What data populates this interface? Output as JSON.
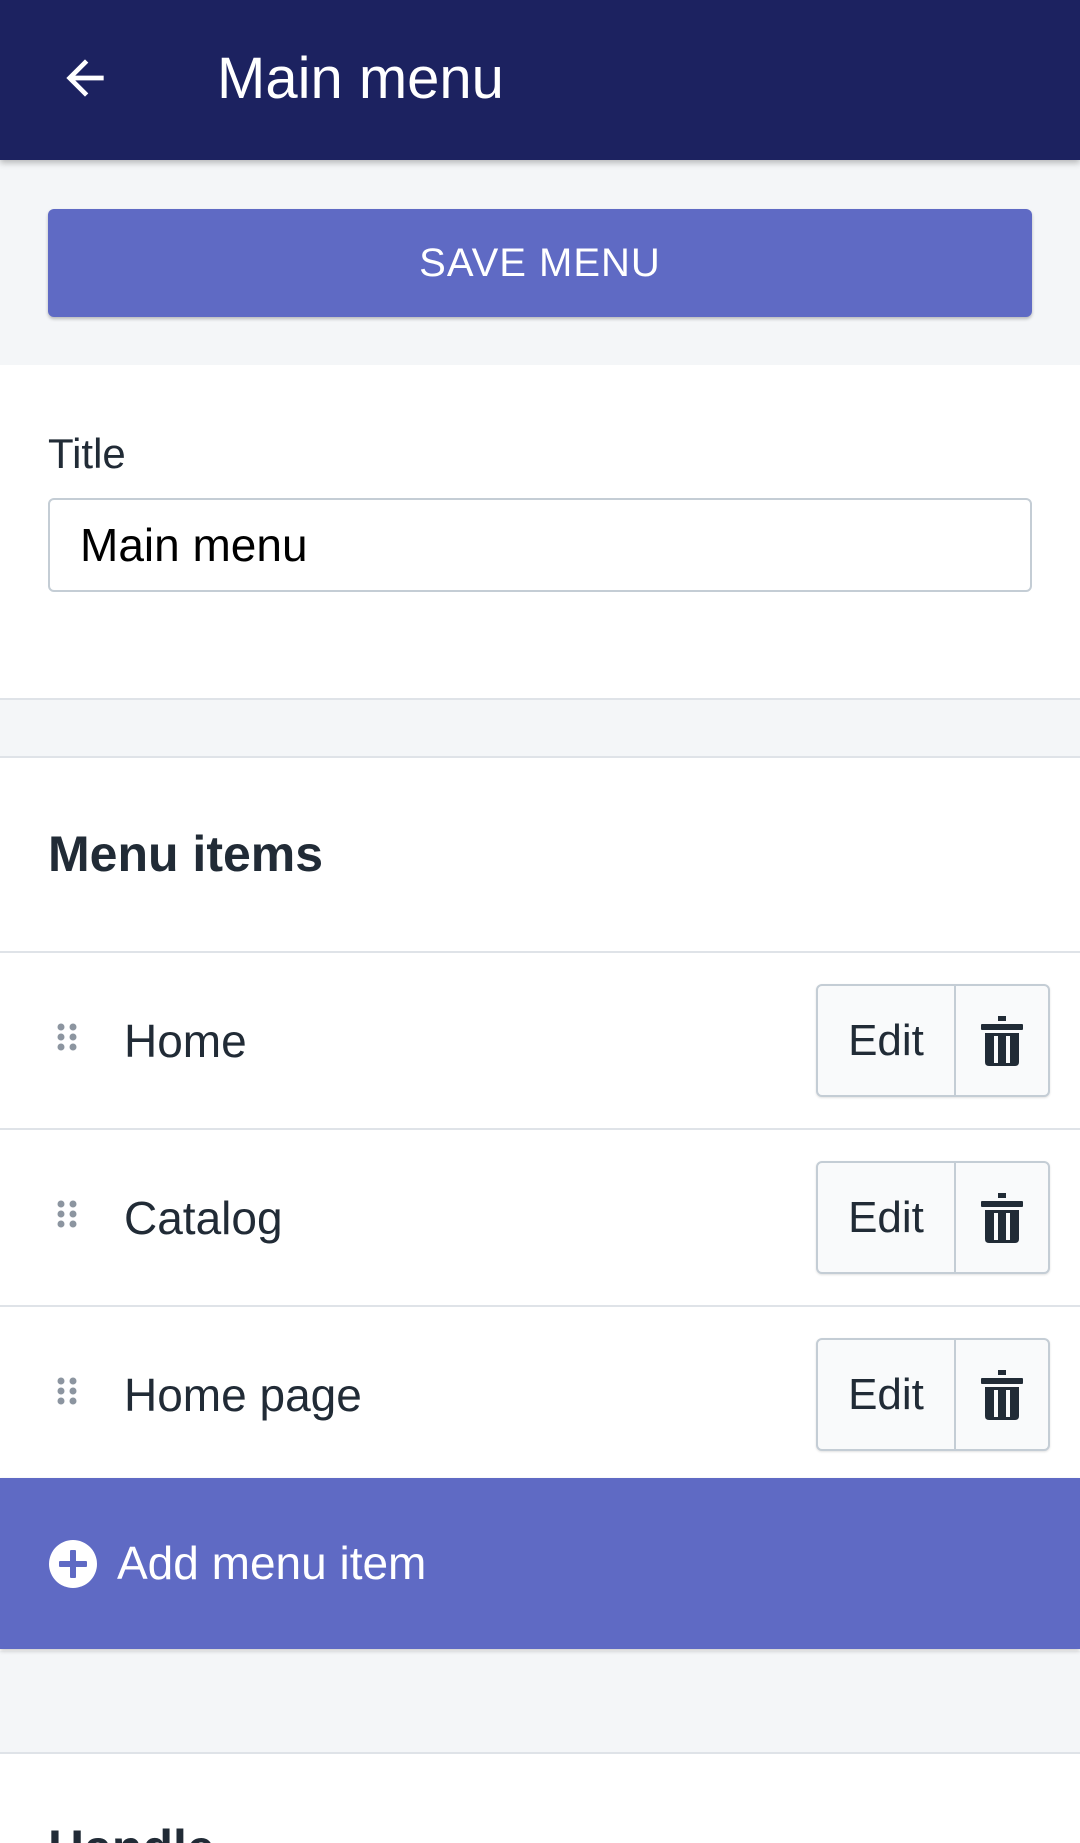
{
  "appbar": {
    "title": "Main menu",
    "back_icon": "arrow-left-icon",
    "background_color": "#1c2260"
  },
  "save": {
    "label": "SAVE MENU",
    "color": "#5f6ac4"
  },
  "title_field": {
    "label": "Title",
    "value": "Main menu"
  },
  "menu_items": {
    "heading": "Menu items",
    "items": [
      {
        "label": "Home",
        "edit_label": "Edit",
        "delete_icon": "trash-icon",
        "drag_icon": "drag-handle-icon"
      },
      {
        "label": "Catalog",
        "edit_label": "Edit",
        "delete_icon": "trash-icon",
        "drag_icon": "drag-handle-icon"
      },
      {
        "label": "Home page",
        "edit_label": "Edit",
        "delete_icon": "trash-icon",
        "drag_icon": "drag-handle-icon"
      }
    ],
    "add_label": "Add menu item",
    "add_icon": "plus-circle-icon"
  },
  "handle": {
    "heading": "Handle"
  }
}
